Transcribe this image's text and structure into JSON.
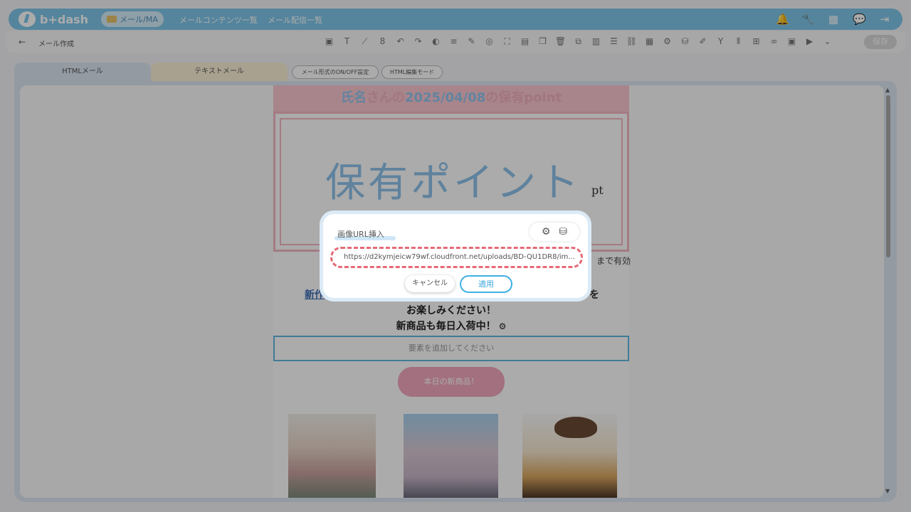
{
  "header": {
    "logo_text": "b+dash",
    "active_pill": "メール/MA",
    "nav": [
      "メールコンテンツ一覧",
      "メール配信一覧"
    ],
    "icons": [
      "bell-icon",
      "wrench-icon",
      "grid-icon",
      "chat-icon",
      "logout-icon"
    ]
  },
  "toolbar": {
    "back_symbol": "←",
    "page_name": "メール作成",
    "save_label": "保存",
    "tool_badge": "8"
  },
  "tabs": {
    "html": "HTMLメール",
    "text": "テキストメール",
    "chip_onoff": "メール形式のON/OFF設定",
    "chip_html_edit": "HTML編集モード"
  },
  "email": {
    "headline_prefix": "氏名",
    "headline_mid": "さんの",
    "headline_date": "2025/04/08",
    "headline_suffix": "の保有point",
    "point_label": "保有ポイント",
    "pt_unit": "pt",
    "valid_text": "まで有効",
    "cta_link": "新作",
    "cta_tail": "を",
    "line2": "お楽しみください！",
    "line3": "新商品も毎日入荷中！",
    "add_element": "要素を追加してください",
    "new_button": "本日の新商品！"
  },
  "dialog": {
    "title": "画像URL挿入",
    "url_value": "https://d2kymjeicw79wf.cloudfront.net/uploads/BD-QU1DR8/im...",
    "cancel_label": "キャンセル",
    "apply_label": "適用"
  }
}
